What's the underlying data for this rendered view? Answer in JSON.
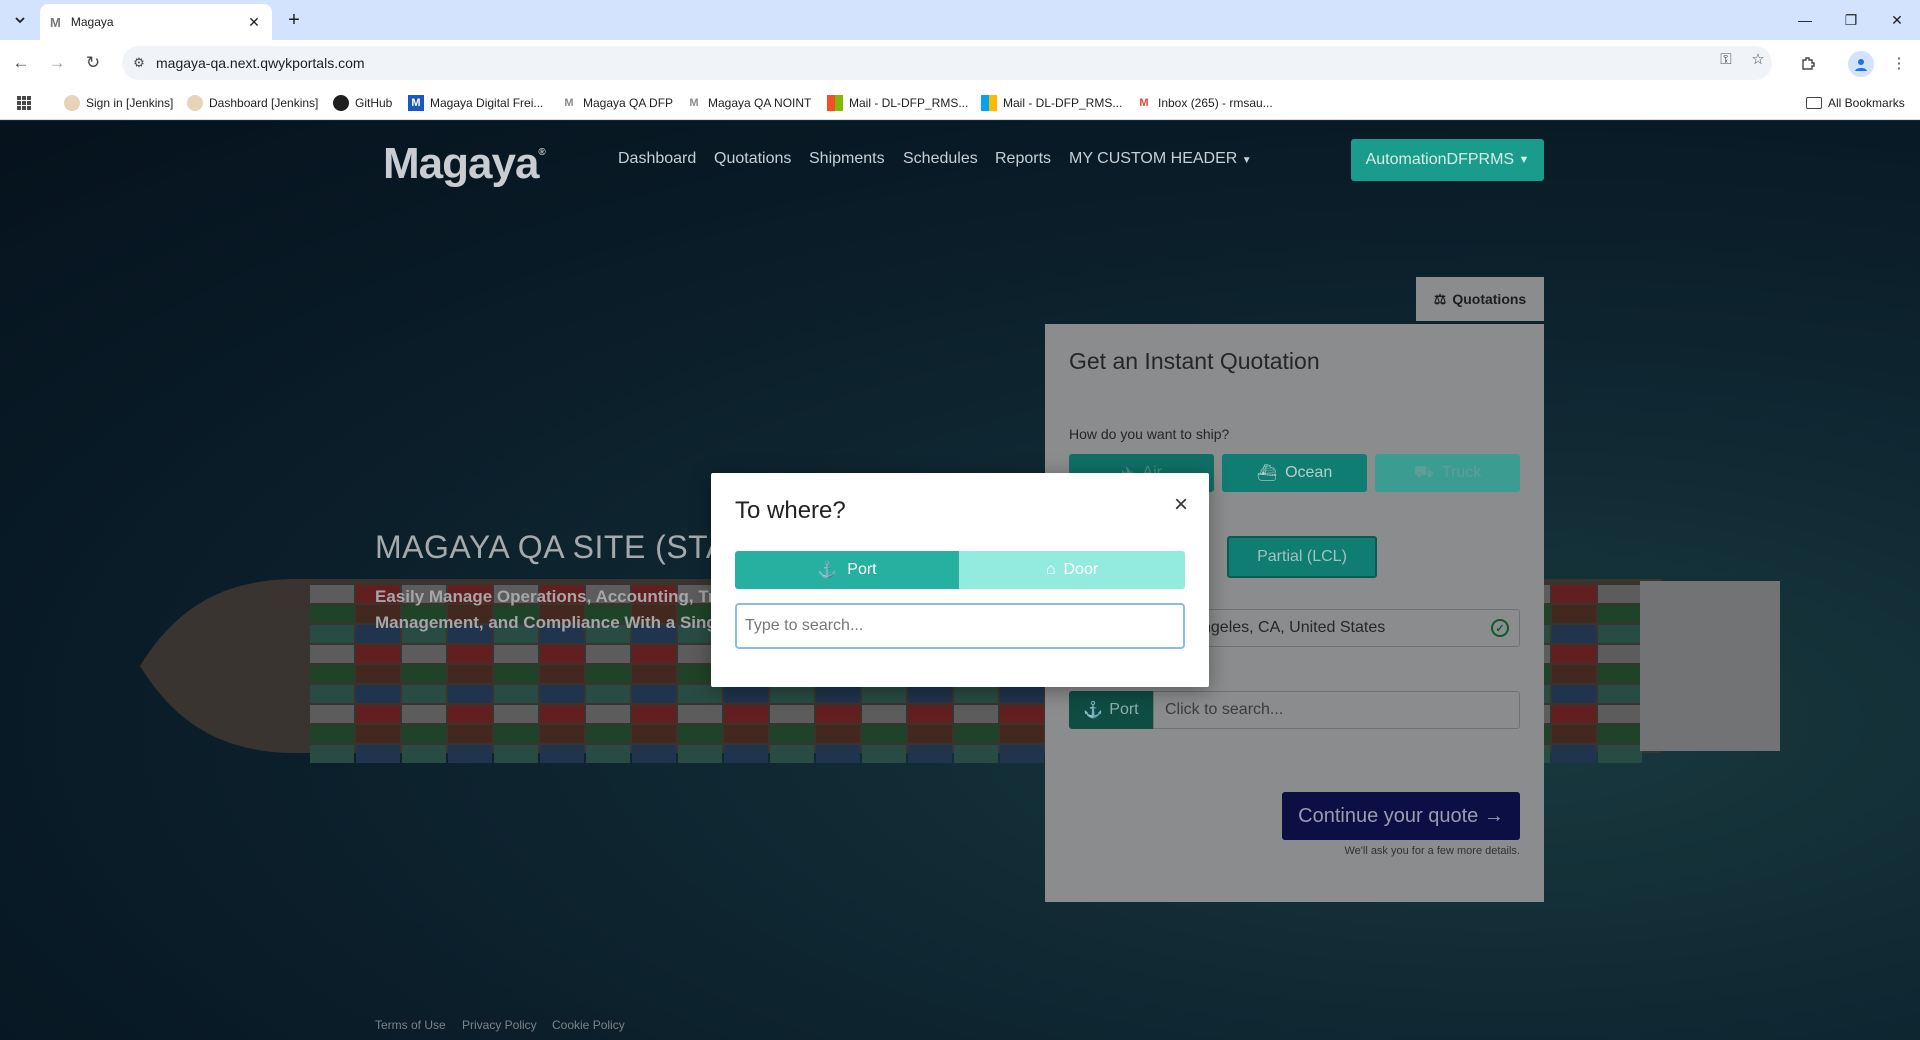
{
  "browser": {
    "tab_title": "Magaya",
    "url": "magaya-qa.next.qwykportals.com",
    "bookmarks": [
      "Sign in [Jenkins]",
      "Dashboard [Jenkins]",
      "GitHub",
      "Magaya Digital Frei...",
      "Magaya QA DFP",
      "Magaya QA NOINT",
      "Mail - DL-DFP_RMS...",
      "Mail - DL-DFP_RMS...",
      "Inbox (265) - rmsau..."
    ],
    "all_bookmarks": "All Bookmarks"
  },
  "site": {
    "logo": "Magaya",
    "nav": [
      "Dashboard",
      "Quotations",
      "Shipments",
      "Schedules",
      "Reports",
      "MY CUSTOM HEADER"
    ],
    "account": "AutomationDFPRMS",
    "accent_color": "#26b09f",
    "hero_title": "MAGAYA QA SITE (STAG",
    "hero_subtitle_line1": "Easily Manage Operations, Accounting, Trac",
    "hero_subtitle_line2": "Management, and Compliance With a Single",
    "footer_links": [
      "Terms of Use",
      "Privacy Policy",
      "Cookie Policy"
    ]
  },
  "quote": {
    "tab_label": "Quotations",
    "title": "Get an Instant Quotation",
    "ship_question": "How do you want to ship?",
    "modes": [
      "Air",
      "Ocean",
      "Truck"
    ],
    "selected_mode": "Ocean",
    "load_type": "Partial (LCL)",
    "from_value": "ngeles, CA, United States",
    "to_label": "To where?",
    "to_port": "Port",
    "to_placeholder": "Click to search...",
    "continue_label": "Continue your quote",
    "continue_note": "We'll ask you for a few more details."
  },
  "modal": {
    "title": "To where?",
    "close": "×",
    "port_label": "Port",
    "door_label": "Door",
    "selected": "Port",
    "search_placeholder": "Type to search..."
  }
}
